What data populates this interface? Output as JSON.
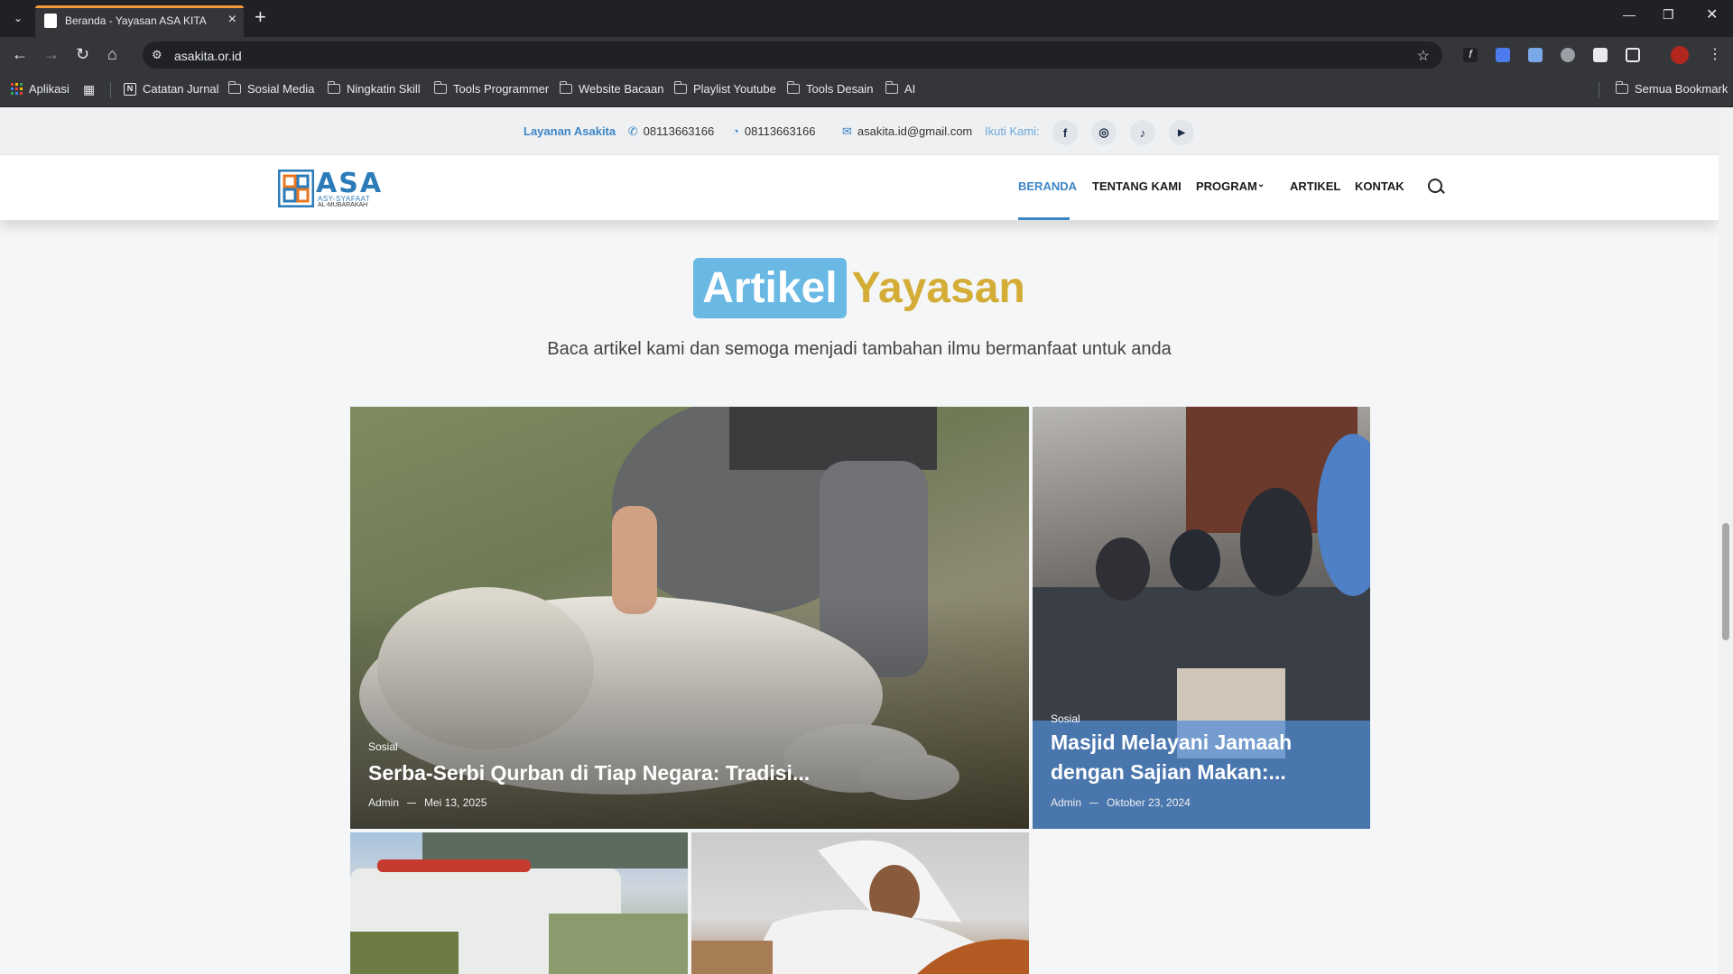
{
  "browser": {
    "tab_title": "Beranda - Yayasan ASA KITA",
    "url": "asakita.or.id",
    "bookmarks": [
      {
        "label": "Aplikasi",
        "icon": "apps-icon"
      },
      {
        "label": "Catatan Jurnal",
        "icon": "notion-icon"
      },
      {
        "label": "Sosial Media",
        "icon": "folder-icon"
      },
      {
        "label": "Ningkatin Skill",
        "icon": "folder-icon"
      },
      {
        "label": "Tools Programmer",
        "icon": "folder-icon"
      },
      {
        "label": "Website Bacaan",
        "icon": "folder-icon"
      },
      {
        "label": "Playlist Youtube",
        "icon": "folder-icon"
      },
      {
        "label": "Tools Desain",
        "icon": "folder-icon"
      },
      {
        "label": "AI",
        "icon": "folder-icon"
      }
    ],
    "all_bookmarks": "Semua Bookmark"
  },
  "topbar": {
    "service_label": "Layanan Asakita",
    "phone": "08113663166",
    "whatsapp": "08113663166",
    "email": "asakita.id@gmail.com",
    "follow_label": "Ikuti Kami:",
    "socials": [
      "facebook-icon",
      "instagram-icon",
      "tiktok-icon",
      "youtube-icon"
    ]
  },
  "header": {
    "logo_text": "ASA",
    "logo_sub1": "ASY-SYAFAAT",
    "logo_sub2": "AL-MUBARAKAH",
    "menu": [
      "BERANDA",
      "TENTANG KAMI",
      "PROGRAM",
      "ARTIKEL",
      "KONTAK"
    ],
    "active_menu": "BERANDA"
  },
  "section": {
    "title_highlight": "Artikel",
    "title_rest": "Yayasan",
    "subtitle": "Baca artikel kami dan semoga menjadi tambahan ilmu bermanfaat untuk anda"
  },
  "articles": [
    {
      "category": "Sosial",
      "title": "Serba-Serbi Qurban di Tiap Negara: Tradisi...",
      "author": "Admin",
      "date": "Mei 13, 2025"
    },
    {
      "category": "Sosial",
      "title": "Masjid Melayani Jamaah dengan Sajian Makan:...",
      "author": "Admin",
      "date": "Oktober 23, 2024"
    },
    {
      "category": "",
      "title": "",
      "author": "",
      "date": ""
    },
    {
      "category": "",
      "title": "",
      "author": "",
      "date": ""
    }
  ],
  "colors": {
    "accent_blue": "#3d86c6",
    "title_highlight_bg": "#6ab9e4",
    "title_gold": "#d4ad37",
    "tab_accent": "#f29a36"
  }
}
